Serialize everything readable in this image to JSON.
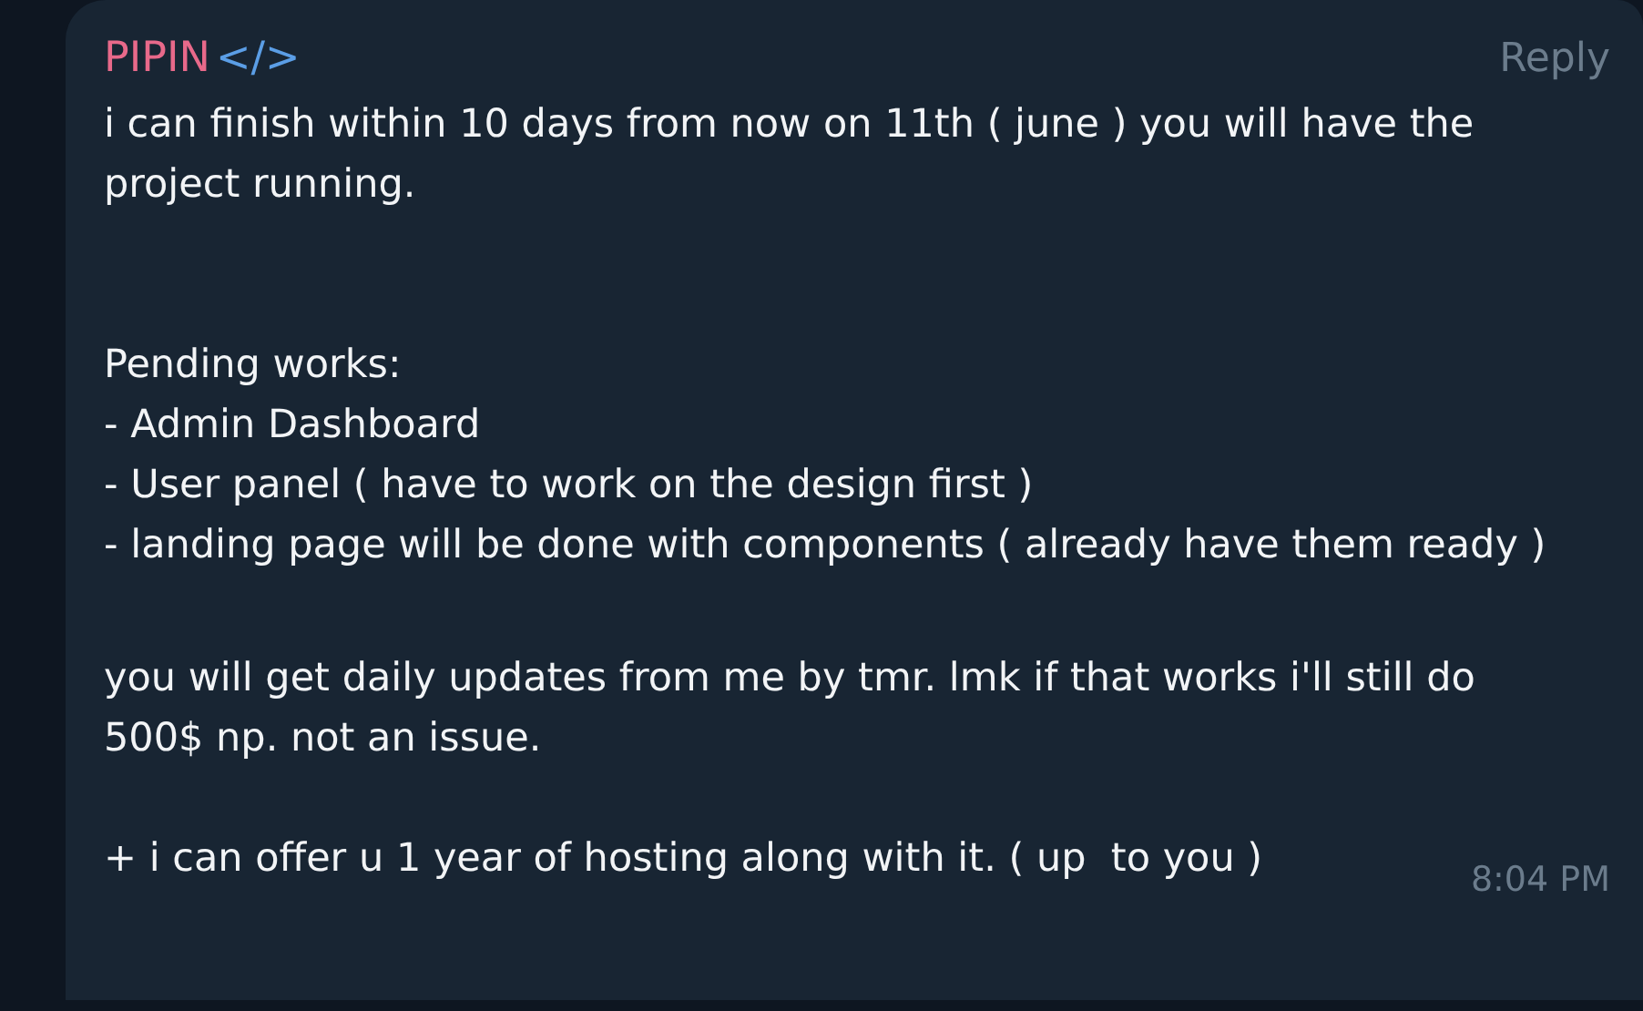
{
  "message": {
    "sender": "PIPIN",
    "sender_tag": "</>",
    "reply": "Reply",
    "paragraphs": [
      "i can finish within 10 days from now on 11th ( june ) you will have the project running.",
      "Pending works:\n- Admin Dashboard\n- User panel ( have to work on the design first )\n- landing page will be done with components ( already have them ready )",
      "you will get daily updates from me by tmr. lmk if that works i'll still do 500$ np. not an issue.",
      "+ i can offer u 1 year of hosting along with it. ( up  to you )"
    ],
    "time": "8:04 PM"
  }
}
